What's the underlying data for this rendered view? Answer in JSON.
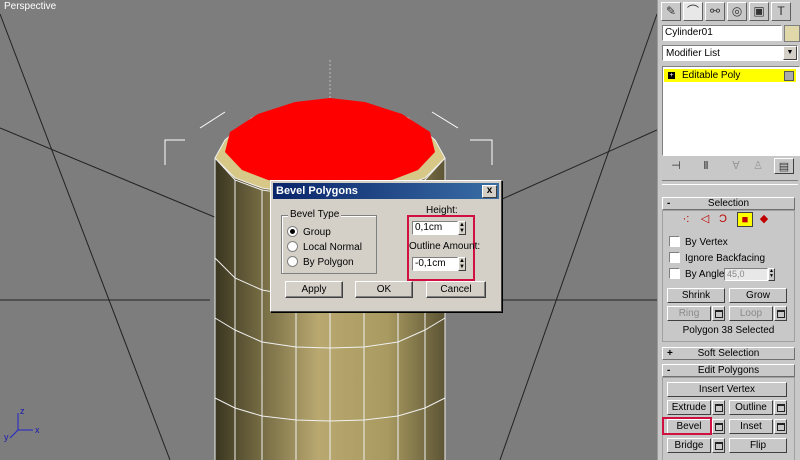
{
  "viewport": {
    "label": "Perspective",
    "gizmo_axes": {
      "x": "x",
      "y": "y",
      "z": "z"
    }
  },
  "dialog": {
    "title": "Bevel Polygons",
    "close_glyph": "x",
    "bevel_type": {
      "label": "Bevel Type",
      "options": [
        "Group",
        "Local Normal",
        "By Polygon"
      ],
      "selected": "Group"
    },
    "height_label": "Height:",
    "height_value": "0,1cm",
    "outline_label": "Outline Amount:",
    "outline_value": "-0,1cm",
    "buttons": {
      "apply": "Apply",
      "ok": "OK",
      "cancel": "Cancel"
    }
  },
  "panel": {
    "tabs": [
      "create-icon",
      "modify-icon",
      "hierarchy-icon",
      "motion-icon",
      "display-icon",
      "utilities-icon"
    ],
    "object_name": "Cylinder01",
    "object_color": "#e0d8a8",
    "modifier_list": "Modifier List",
    "stack_items": [
      {
        "label": "Editable Poly",
        "expand": "+"
      }
    ],
    "stack_tools": [
      "pin-stack-icon",
      "show-end-result-icon",
      "make-unique-icon",
      "remove-modifier-icon",
      "configure-sets-icon"
    ],
    "selection": {
      "title": "Selection",
      "sign": "-",
      "subobject_levels": [
        "vertex-icon",
        "edge-icon",
        "border-icon",
        "polygon-icon",
        "element-icon"
      ],
      "active_level": "polygon-icon",
      "by_vertex": "By Vertex",
      "ignore_backfacing": "Ignore Backfacing",
      "by_angle": "By Angle:",
      "angle_value": "45,0",
      "shrink": "Shrink",
      "grow": "Grow",
      "ring": "Ring",
      "loop": "Loop",
      "status": "Polygon 38 Selected"
    },
    "soft_selection": {
      "title": "Soft Selection",
      "sign": "+"
    },
    "edit_polygons": {
      "title": "Edit Polygons",
      "sign": "-",
      "insert_vertex": "Insert Vertex",
      "extrude": "Extrude",
      "outline": "Outline",
      "bevel": "Bevel",
      "inset": "Inset",
      "bridge": "Bridge",
      "flip": "Flip"
    }
  },
  "colors": {
    "selected_face": "#ff0000",
    "highlight_box": "#d01040",
    "stack_highlight": "#ffff00",
    "viewport_bg": "#7d7d7d"
  }
}
